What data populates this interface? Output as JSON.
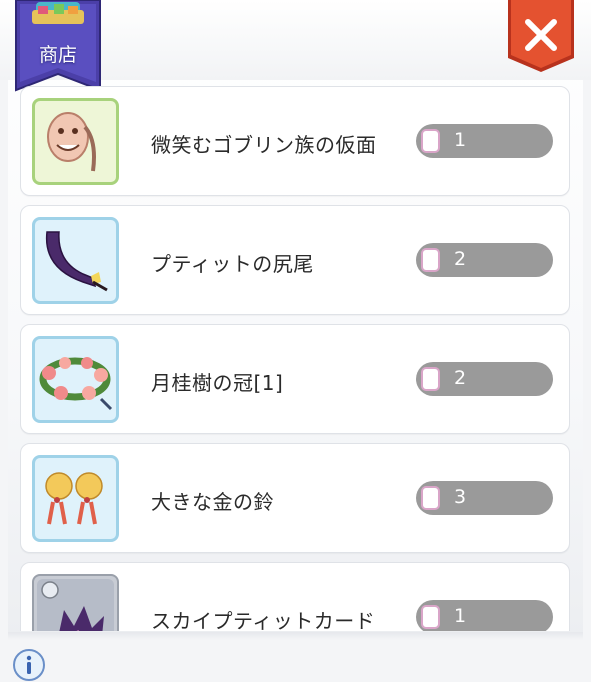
{
  "header": {
    "shop_label": "商店"
  },
  "items": [
    {
      "name": "微笑むゴブリン族の仮面",
      "quantity": "1",
      "icon": "goblin-mask-icon"
    },
    {
      "name": "プティットの尻尾",
      "quantity": "2",
      "icon": "petite-tail-icon"
    },
    {
      "name": "月桂樹の冠[1]",
      "quantity": "2",
      "icon": "laurel-crown-icon"
    },
    {
      "name": "大きな金の鈴",
      "quantity": "3",
      "icon": "golden-bells-icon"
    },
    {
      "name": "スカイプティットカード",
      "quantity": "1",
      "icon": "sky-petite-card-icon"
    }
  ],
  "colors": {
    "close_button": "#e0452a",
    "badge": "#4a3fa8",
    "quantity_pill": "#9a9a9a"
  }
}
